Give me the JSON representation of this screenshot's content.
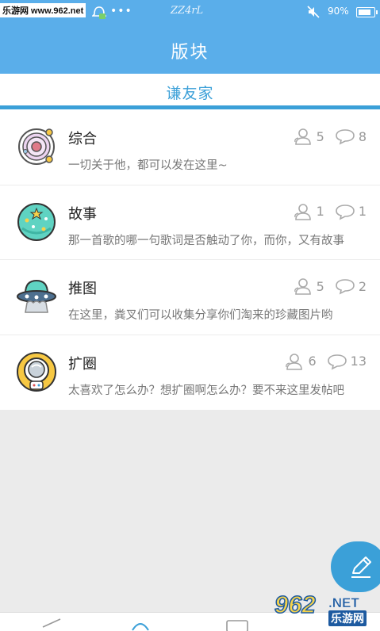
{
  "status_bar": {
    "watermark": "乐游网 www.962.net",
    "dots": "•••",
    "carrier": "ZZ4rL",
    "battery": "90%"
  },
  "header": {
    "title": "版块"
  },
  "tabs": [
    {
      "label": "谦友家",
      "active": true
    }
  ],
  "sections": [
    {
      "title": "综合",
      "desc": "一切关于他，都可以发在这里~",
      "members": "5",
      "posts": "8",
      "icon": "planet-icon"
    },
    {
      "title": "故事",
      "desc": "那一首歌的哪一句歌词是否触动了你，而你，又有故事",
      "members": "1",
      "posts": "1",
      "icon": "moon-star-icon"
    },
    {
      "title": "推图",
      "desc": "在这里，粪叉们可以收集分享你们淘来的珍藏图片哟",
      "members": "5",
      "posts": "2",
      "icon": "ufo-icon"
    },
    {
      "title": "扩圈",
      "desc": "太喜欢了怎么办？想扩圈啊怎么办？要不来这里发帖吧",
      "members": "6",
      "posts": "13",
      "icon": "astronaut-icon"
    }
  ],
  "fab": {
    "icon": "edit-pencil-icon"
  },
  "bottom_watermark": {
    "logo": "962",
    "site": ".NET",
    "name": "乐游网"
  },
  "colors": {
    "primary": "#5aaeea",
    "accent": "#3ba0d8"
  }
}
